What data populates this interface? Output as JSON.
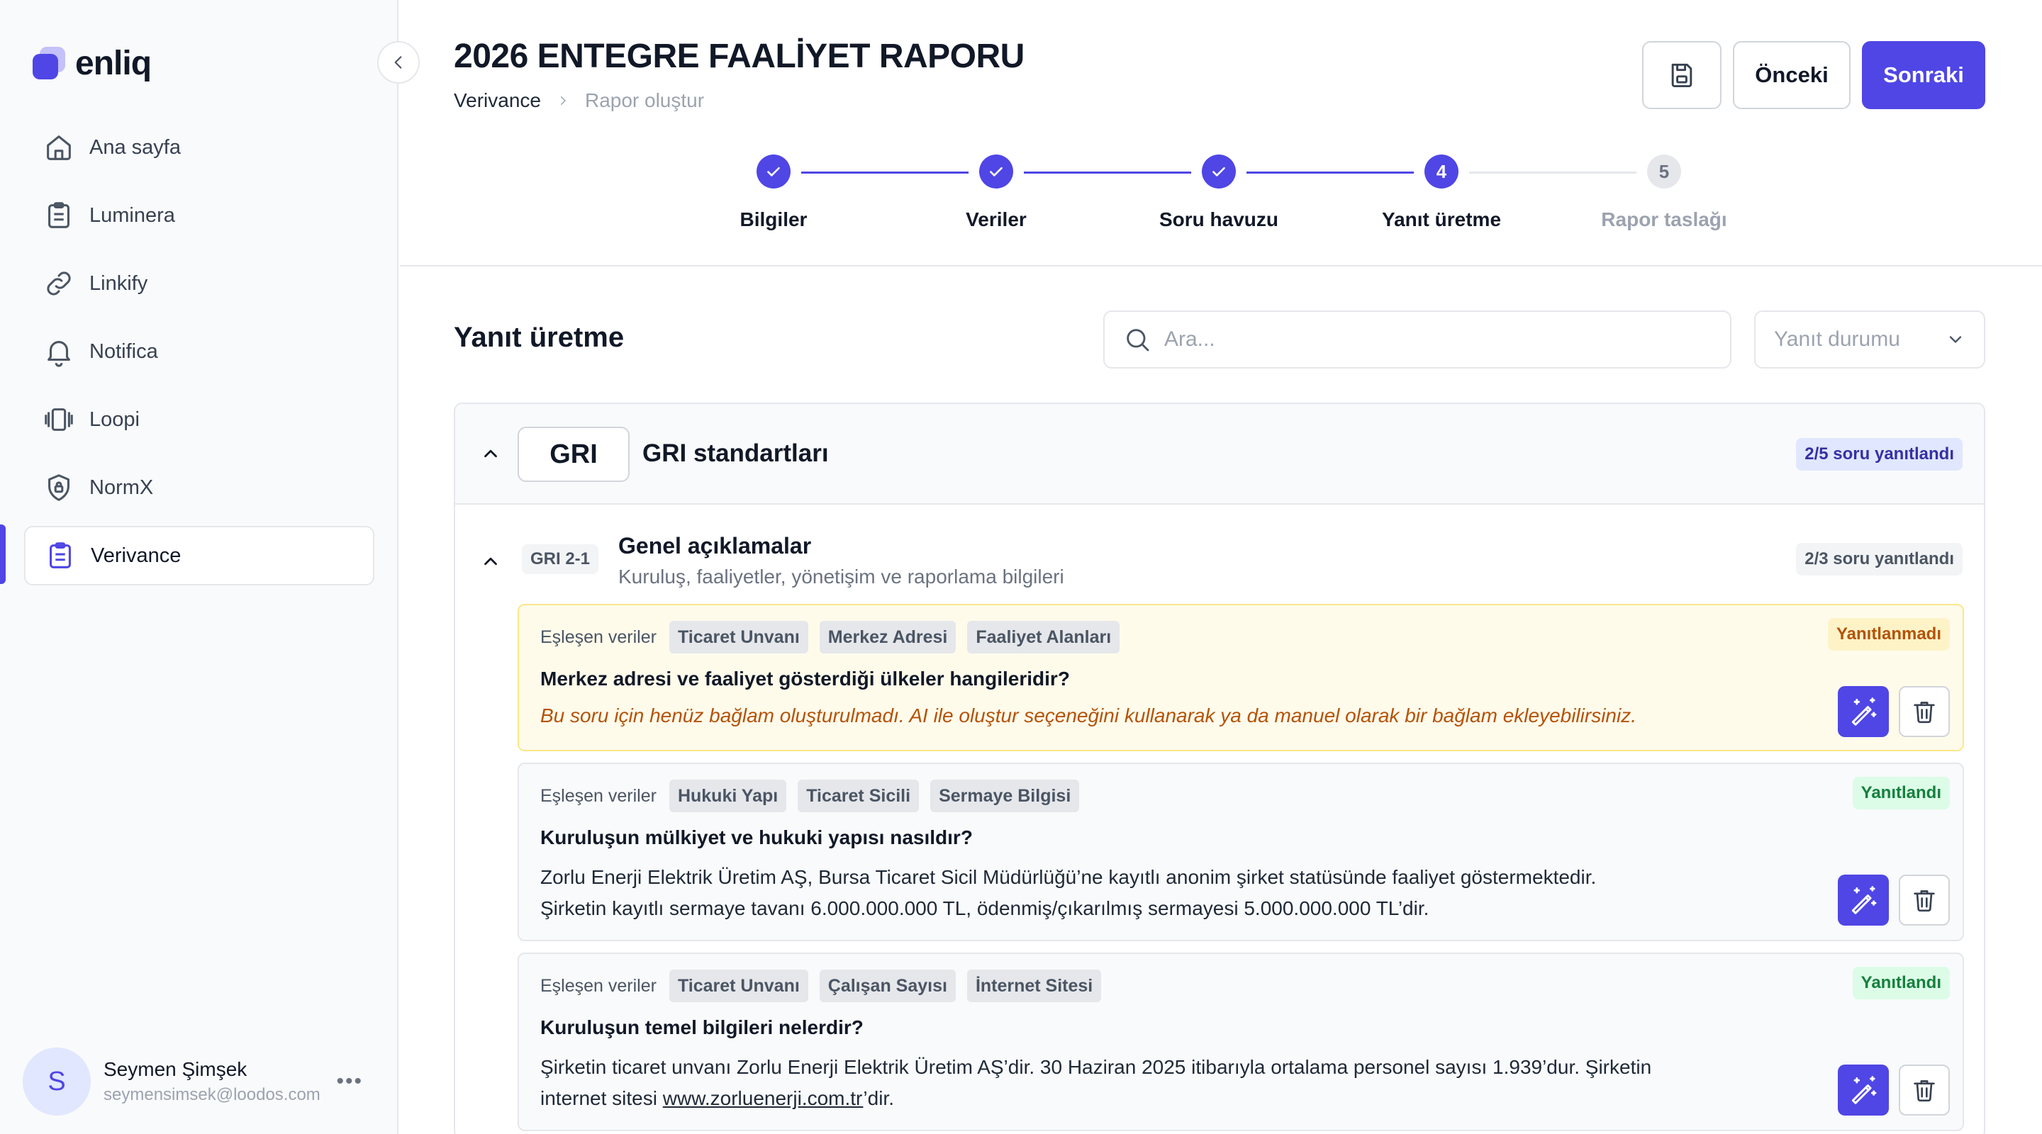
{
  "app": {
    "logo_text": "enliq"
  },
  "sidebar": {
    "items": [
      {
        "label": "Ana sayfa",
        "icon": "home-icon"
      },
      {
        "label": "Luminera",
        "icon": "clipboard-icon"
      },
      {
        "label": "Linkify",
        "icon": "link-icon"
      },
      {
        "label": "Notifica",
        "icon": "bell-icon"
      },
      {
        "label": "Loopi",
        "icon": "carousel-icon"
      },
      {
        "label": "NormX",
        "icon": "shield-lock-icon"
      },
      {
        "label": "Verivance",
        "icon": "clipboard-list-icon",
        "active": true
      }
    ],
    "user": {
      "initial": "S",
      "name": "Seymen Şimşek",
      "email": "seymensimsek@loodos.com"
    }
  },
  "header": {
    "title": "2026 ENTEGRE FAALİYET RAPORU",
    "breadcrumb": [
      "Verivance",
      "Rapor oluştur"
    ],
    "buttons": {
      "prev": "Önceki",
      "next": "Sonraki"
    }
  },
  "stepper": {
    "steps": [
      {
        "label": "Bilgiler",
        "status": "done"
      },
      {
        "label": "Veriler",
        "status": "done"
      },
      {
        "label": "Soru havuzu",
        "status": "done"
      },
      {
        "label": "Yanıt üretme",
        "status": "current",
        "number": "4"
      },
      {
        "label": "Rapor taslağı",
        "status": "todo",
        "number": "5"
      }
    ]
  },
  "main": {
    "title": "Yanıt üretme",
    "search_placeholder": "Ara...",
    "status_filter": "Yanıt durumu",
    "group": {
      "code": "GRI",
      "title": "GRI standartları",
      "progress": "2/5 soru yanıtlandı",
      "section": {
        "code": "GRI 2-1",
        "title": "Genel açıklamalar",
        "description": "Kuruluş, faaliyetler, yönetişim ve raporlama bilgileri",
        "progress": "2/3 soru yanıtlandı",
        "matched_label": "Eşleşen veriler",
        "questions": [
          {
            "tags": [
              "Ticaret Unvanı",
              "Merkez Adresi",
              "Faaliyet Alanları"
            ],
            "status": "Yanıtlanmadı",
            "question": "Merkez adresi ve faaliyet gösterdiği ülkeler hangileridir?",
            "answer": "Bu soru için henüz bağlam oluşturulmadı. AI ile oluştur seçeneğini kullanarak ya da manuel olarak bir bağlam ekleyebilirsiniz."
          },
          {
            "tags": [
              "Hukuki Yapı",
              "Ticaret Sicili",
              "Sermaye Bilgisi"
            ],
            "status": "Yanıtlandı",
            "question": "Kuruluşun mülkiyet ve hukuki yapısı nasıldır?",
            "answer_line1": "Zorlu Enerji Elektrik Üretim AŞ, Bursa Ticaret Sicil Müdürlüğü’ne kayıtlı anonim şirket statüsünde faaliyet göstermektedir.",
            "answer_line2": "Şirketin kayıtlı sermaye tavanı 6.000.000.000 TL, ödenmiş/çıkarılmış sermayesi 5.000.000.000 TL’dir."
          },
          {
            "tags": [
              "Ticaret Unvanı",
              "Çalışan Sayısı",
              "İnternet Sitesi"
            ],
            "status": "Yanıtlandı",
            "question": "Kuruluşun temel bilgileri nelerdir?",
            "answer_line1": "Şirketin ticaret unvanı Zorlu Enerji Elektrik Üretim AŞ’dir. 30 Haziran 2025 itibarıyla ortalama personel sayısı 1.939’dur. Şirketin",
            "answer_line2_prefix": "internet sitesi ",
            "answer_link": "www.zorluenerji.com.tr",
            "answer_line2_suffix": "’dir."
          }
        ]
      }
    }
  },
  "colors": {
    "accent": "#4f46e5",
    "warning": "#b45309",
    "success": "#15803d"
  }
}
